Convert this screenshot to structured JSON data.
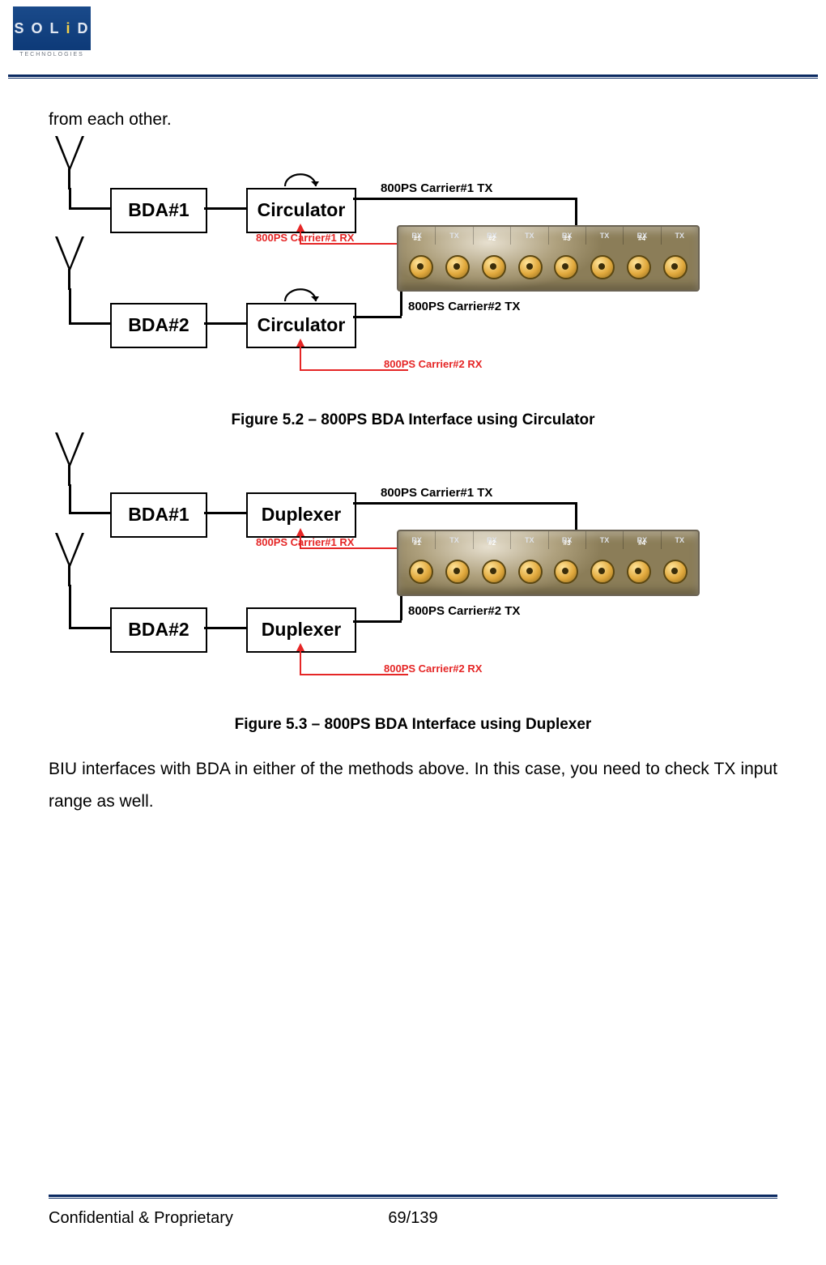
{
  "logo": {
    "main": "SOLiD",
    "sub": "TECHNOLOGIES"
  },
  "body": {
    "lead": "from each other.",
    "caption1": "Figure 5.2 – 800PS BDA Interface using Circulator",
    "caption2": "Figure 5.3 – 800PS BDA Interface using Duplexer",
    "paragraph": "BIU interfaces with BDA in either of the methods above. In this case, you need to check TX input range as well."
  },
  "diagrams": {
    "circulator": {
      "bda1": "BDA#1",
      "bda2": "BDA#2",
      "node": "Circulator",
      "tx1": "800PS Carrier#1 TX",
      "rx1": "800PS Carrier#1 RX",
      "tx2": "800PS Carrier#2 TX",
      "rx2": "800PS Carrier#2 RX"
    },
    "duplexer": {
      "bda1": "BDA#1",
      "bda2": "BDA#2",
      "node": "Duplexer",
      "tx1": "800PS Carrier#1 TX",
      "rx1": "800PS Carrier#1 RX",
      "tx2": "800PS Carrier#2 TX",
      "rx2": "800PS Carrier#2 RX"
    },
    "panel": {
      "ports": [
        "RX",
        "TX",
        "RX",
        "TX",
        "RX",
        "TX",
        "RX",
        "TX"
      ],
      "groups": [
        "#1",
        "",
        "#2",
        "",
        "#3",
        "",
        "#4",
        ""
      ]
    }
  },
  "footer": {
    "left": "Confidential & Proprietary",
    "page": "69/139"
  }
}
